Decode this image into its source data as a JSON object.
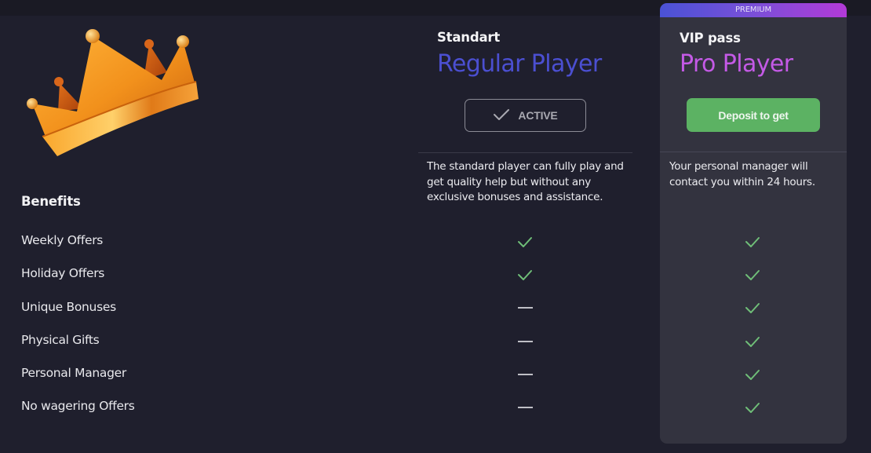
{
  "colors": {
    "background": "#1f1f2d",
    "vip_card": "#33333f",
    "regular_accent": "#4b4fd1",
    "pro_accent": "#c45ae6",
    "deposit_button": "#5cb263",
    "check": "#6fbe78"
  },
  "hero": {
    "icon": "crown-icon"
  },
  "benefits": {
    "title": "Benefits",
    "items": [
      {
        "label": "Weekly Offers",
        "standard": "check",
        "vip": "check"
      },
      {
        "label": "Holiday Offers",
        "standard": "check",
        "vip": "check"
      },
      {
        "label": "Unique Bonuses",
        "standard": "dash",
        "vip": "check"
      },
      {
        "label": "Physical Gifts",
        "standard": "dash",
        "vip": "check"
      },
      {
        "label": "Personal Manager",
        "standard": "dash",
        "vip": "check"
      },
      {
        "label": "No wagering Offers",
        "standard": "dash",
        "vip": "check"
      }
    ]
  },
  "standard_plan": {
    "subtitle": "Standart",
    "name": "Regular Player",
    "button_label": "ACTIVE",
    "button_icon": "check-icon",
    "description": "The standard player can fully play and get quality help but without any exclusive bonuses and assistance."
  },
  "vip_plan": {
    "badge": "PREMIUM",
    "subtitle": "VIP pass",
    "name": "Pro Player",
    "button_label": "Deposit to get",
    "description": "Your personal manager will contact you within 24 hours."
  }
}
